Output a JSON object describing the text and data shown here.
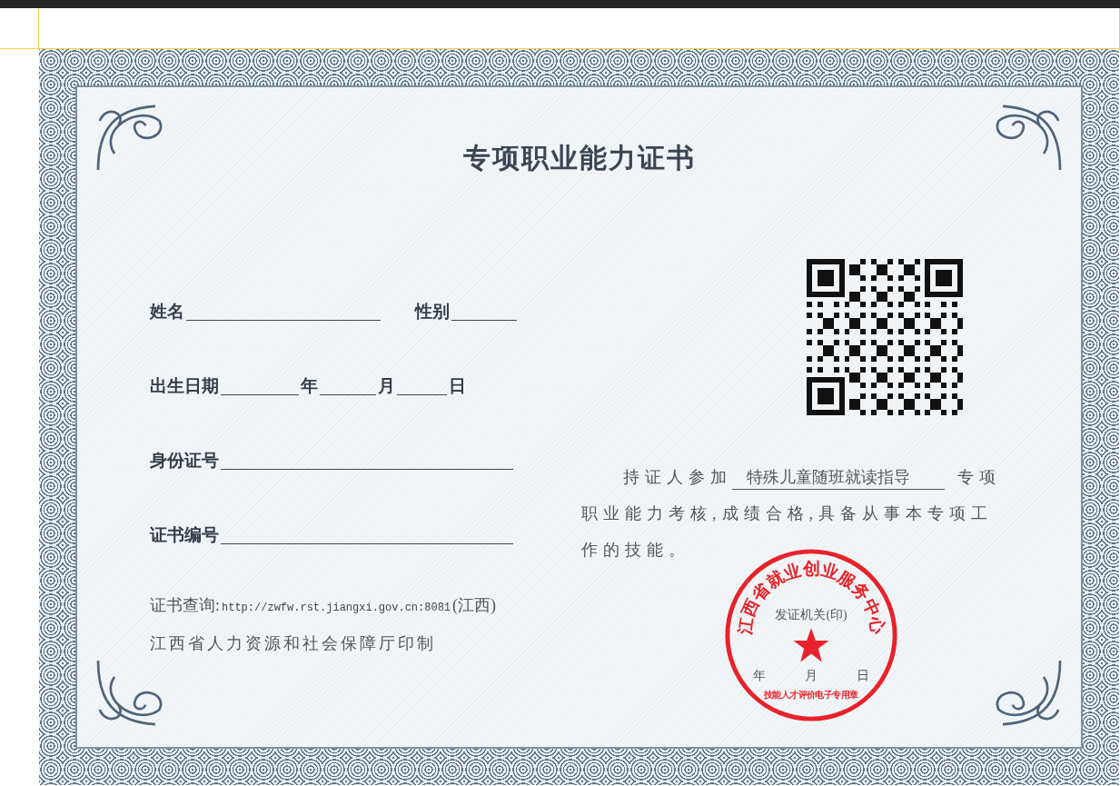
{
  "certificate": {
    "title": "专项职业能力证书",
    "fields": [
      {
        "label": "姓名"
      },
      {
        "label": "性别"
      }
    ],
    "birth_date": {
      "label": "出生日期",
      "year": "年",
      "month": "月",
      "day": "日"
    },
    "id_field": {
      "label": "身份证号"
    },
    "number_field": {
      "label": "证书编号"
    },
    "statement": {
      "intro": "持证人参加",
      "course": "特殊儿童随班就读指导",
      "closing": "专项职业能力考核,成绩合格,具备从事本专项工作的技能。"
    },
    "query": {
      "label": "证书查询:",
      "url": "http://zwfw.rst.jiangxi.gov.cn:8081",
      "region": "(江西)"
    },
    "printer": "江西省人力资源和社会保障厅印制",
    "issuer": "发证机关(印)",
    "issue_date": {
      "year": "年",
      "month": "月",
      "day": "日"
    },
    "seal": {
      "ring_text": "江西省就业创业服务中心",
      "bottom_text": "技能人才评价电子专用章"
    }
  }
}
